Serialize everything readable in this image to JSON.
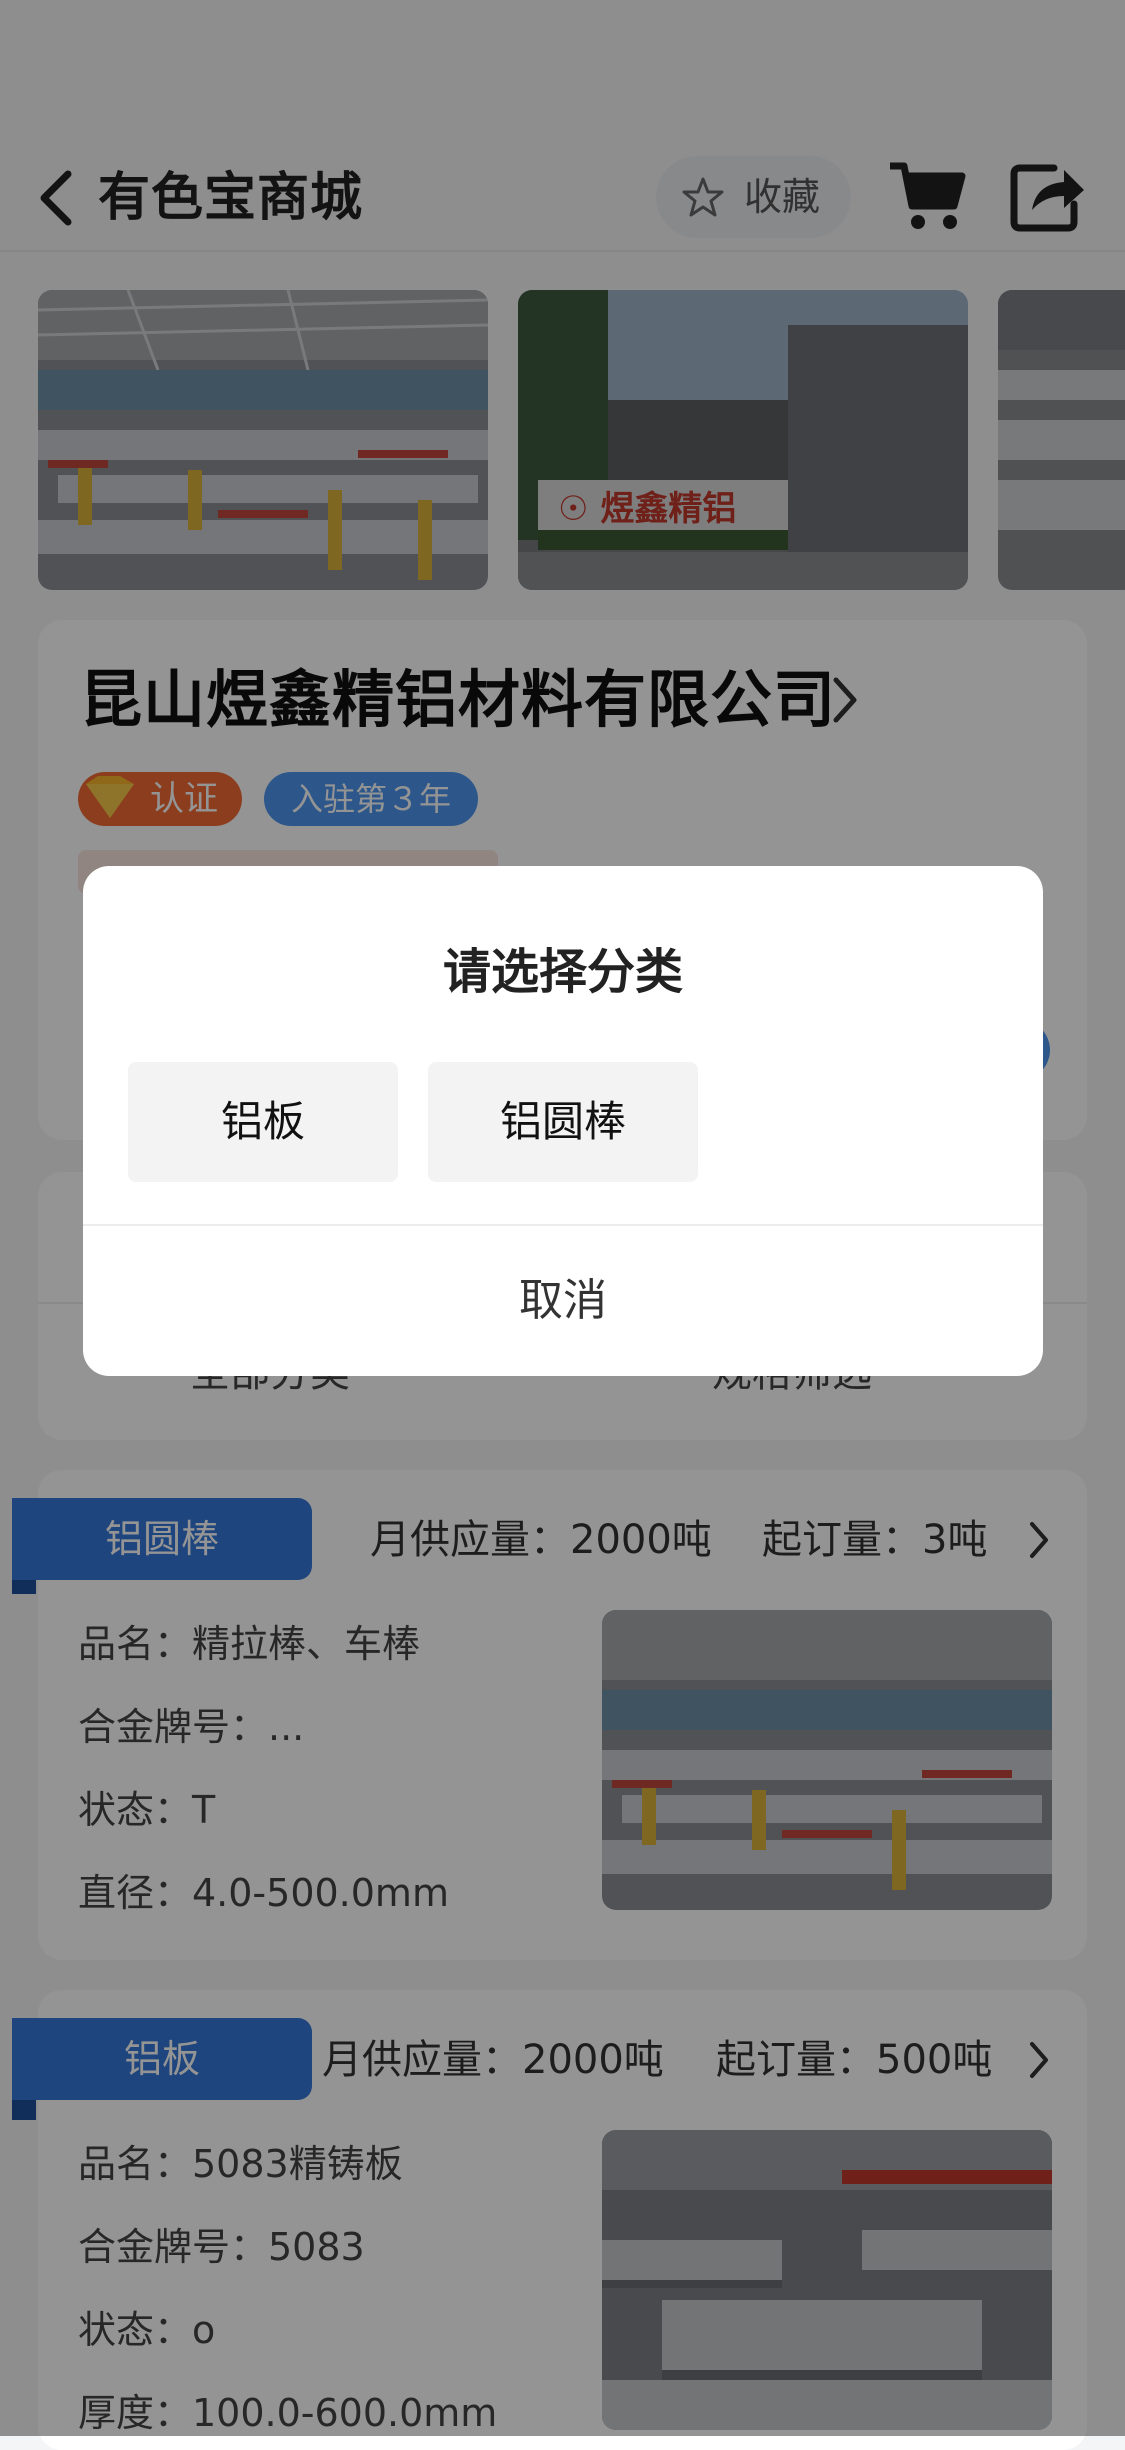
{
  "nav": {
    "title": "有色宝商城",
    "favorite_label": "收藏"
  },
  "company": {
    "name": "昆山煜鑫精铝材料有限公司",
    "cert_badge": "认证",
    "years_badge": "入驻第３年"
  },
  "filters": {
    "all_categories": "全部分类",
    "spec_filter": "规格筛选"
  },
  "products": [
    {
      "tag": "铝圆棒",
      "supply": "月供应量：2000吨",
      "moq": "起订量：3吨",
      "lines": [
        "品名：精拉棒、车棒",
        "合金牌号：...",
        "状态：T",
        "直径：4.0-500.0mm"
      ]
    },
    {
      "tag": "铝板",
      "supply": "月供应量：2000吨",
      "moq": "起订量：500吨",
      "lines": [
        "品名：5083精铸板",
        "合金牌号：5083",
        "状态：o",
        "厚度：100.0-600.0mm"
      ]
    }
  ],
  "modal": {
    "title": "请选择分类",
    "options": [
      "铝板",
      "铝圆棒"
    ],
    "cancel": "取消"
  },
  "colors": {
    "accent_blue": "#3478d9",
    "cert_orange": "#f06a33",
    "year_blue": "#4e97ef"
  },
  "icons": [
    "back-icon",
    "star-icon",
    "cart-icon",
    "share-icon",
    "chevron-right-icon",
    "diamond-icon"
  ]
}
